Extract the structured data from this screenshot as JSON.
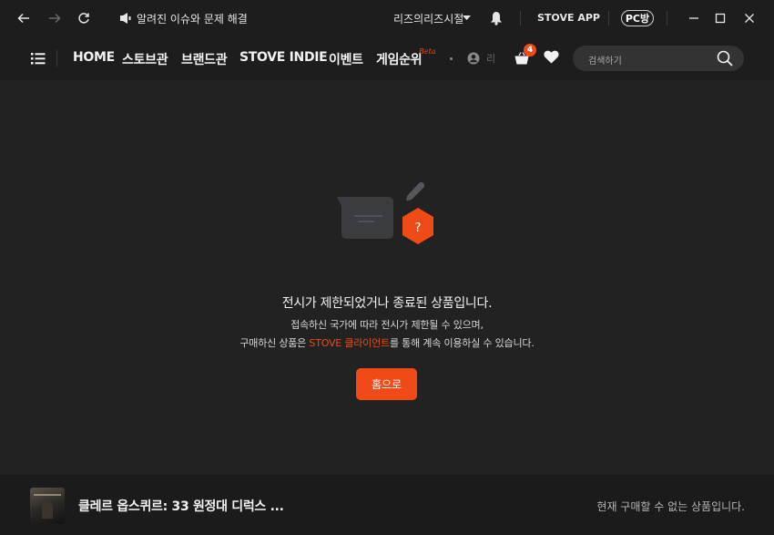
{
  "titlebar": {
    "notice_label": "알려진 이슈와 문제 해결",
    "user_name": "리즈의리즈시절",
    "app_label": "STOVE APP",
    "pc_label": "PC방"
  },
  "nav": {
    "items": [
      {
        "label": "HOME"
      },
      {
        "label": "스토브관"
      },
      {
        "label": "브랜드관"
      },
      {
        "label": "STOVE INDIE"
      },
      {
        "label": "이벤트"
      },
      {
        "label": "게임순위"
      }
    ],
    "beta_label": "Beta",
    "profile_label": "리",
    "cart_count": "4",
    "search_placeholder": "검색하기"
  },
  "message": {
    "title": "전시가 제한되었거나 종료된 상품입니다.",
    "line1": "접속하신 국가에 따라 전시가 제한될 수 있으며,",
    "line2_before": "구매하신 상품은 ",
    "line2_link": "STOVE 클라이언트",
    "line2_after": "를 통해 계속 이용하실 수 있습니다.",
    "home_button": "홈으로"
  },
  "product": {
    "title": "클레르 옵스퀴르: 33 원정대 디럭스 ...",
    "status": "현재 구매할 수 없는 상품입니다."
  },
  "colors": {
    "accent": "#f04a18",
    "background": "#222222",
    "bar": "#1d1d1d"
  },
  "icons": [
    "back-icon",
    "forward-icon",
    "refresh-icon",
    "notice-icon",
    "chevron-down-icon",
    "bell-icon",
    "minimize-icon",
    "maximize-icon",
    "close-icon",
    "menu-icon",
    "profile-icon",
    "cart-icon",
    "heart-icon",
    "search-icon",
    "chat-question-illustration"
  ]
}
